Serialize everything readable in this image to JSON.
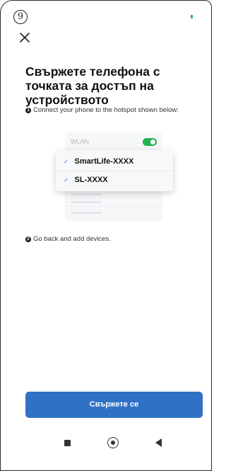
{
  "header": {
    "step_number": "9",
    "close_icon": "close-icon",
    "status_color": "#20b34a"
  },
  "title": "Свържете телефона с точката за достъп на устройството",
  "steps": [
    {
      "marker": "1",
      "text": "Connect your phone to the hotspot shown below:"
    },
    {
      "marker": "2",
      "text": "Go back and add devices."
    }
  ],
  "illustration": {
    "wlan_label": "WLAN",
    "wlan_toggle_on": true,
    "networks": [
      {
        "name": "SmartLife-XXXX",
        "check": "✓"
      },
      {
        "name": "SL-XXXX",
        "check": "✓"
      }
    ]
  },
  "connect_button": {
    "label": "Свържете се",
    "color": "#2f72c5"
  },
  "nav_bar": {
    "icons": [
      "recents-square-icon",
      "home-circle-icon",
      "back-triangle-icon"
    ]
  }
}
